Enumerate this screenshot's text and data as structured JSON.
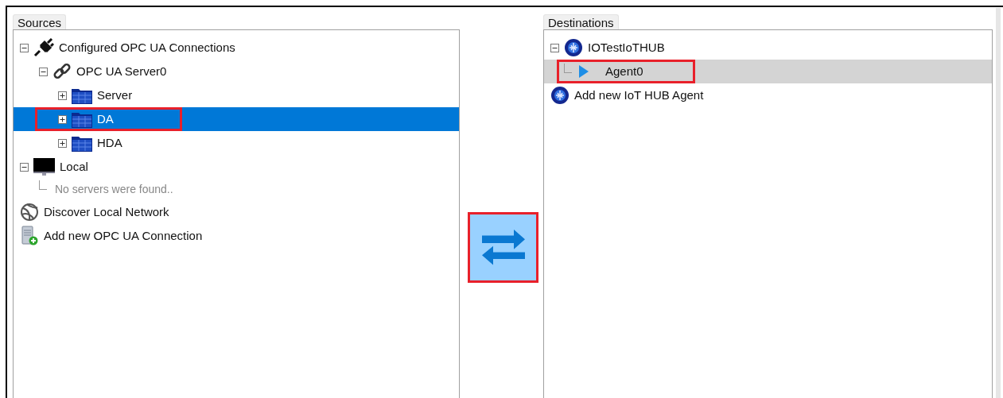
{
  "sources": {
    "title": "Sources",
    "items": [
      {
        "label": "Configured OPC UA Connections",
        "kind": "connections",
        "expanded": true,
        "selected": false,
        "highlighted": false,
        "children": [
          {
            "label": "OPC UA Server0",
            "kind": "server",
            "expanded": true,
            "selected": false,
            "highlighted": false,
            "children": [
              {
                "label": "Server",
                "kind": "folder",
                "expanded": false,
                "selected": false,
                "highlighted": false
              },
              {
                "label": "DA",
                "kind": "folder",
                "expanded": false,
                "selected": true,
                "highlighted": true
              },
              {
                "label": "HDA",
                "kind": "folder",
                "expanded": false,
                "selected": false,
                "highlighted": false
              }
            ]
          }
        ]
      },
      {
        "label": "Local",
        "kind": "computer",
        "expanded": true,
        "selected": false,
        "highlighted": false,
        "children": [
          {
            "label": "No servers were found..",
            "kind": "note",
            "selected": false,
            "highlighted": false
          }
        ]
      },
      {
        "label": "Discover Local Network",
        "kind": "discover",
        "selected": false,
        "highlighted": false
      },
      {
        "label": "Add new OPC UA Connection",
        "kind": "addconnection",
        "selected": false,
        "highlighted": false
      }
    ]
  },
  "transfer_button": {
    "highlighted": true
  },
  "destinations": {
    "title": "Destinations",
    "items": [
      {
        "label": "IOTestIoTHUB",
        "kind": "hub",
        "expanded": true,
        "selected": false,
        "highlighted": false,
        "children": [
          {
            "label": "Agent0",
            "kind": "agent",
            "selected": true,
            "highlighted": true
          }
        ]
      },
      {
        "label": "Add new IoT HUB Agent",
        "kind": "hub",
        "selected": false,
        "highlighted": false
      }
    ]
  }
}
